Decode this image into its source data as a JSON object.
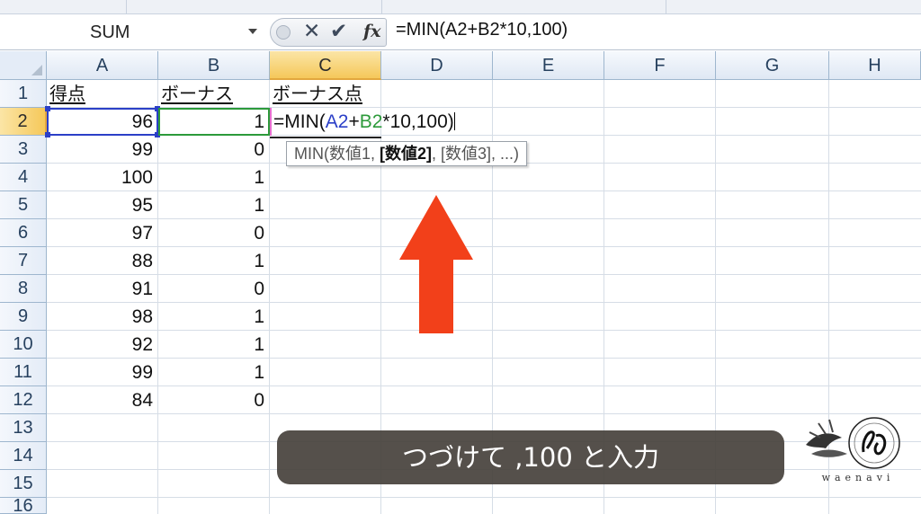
{
  "formula_bar": {
    "name_box": "SUM",
    "cancel_glyph": "✕",
    "enter_glyph": "✔",
    "fx_label": "fx",
    "content": "=MIN(A2+B2*10,100)"
  },
  "columns": [
    "A",
    "B",
    "C",
    "D",
    "E",
    "F",
    "G",
    "H"
  ],
  "active_column": "C",
  "rows": [
    "1",
    "2",
    "3",
    "4",
    "5",
    "6",
    "7",
    "8",
    "9",
    "10",
    "11",
    "12",
    "13",
    "14",
    "15",
    "16"
  ],
  "active_row": "2",
  "headers": {
    "a1": "得点",
    "b1": "ボーナス",
    "c1": "ボーナス点"
  },
  "data_rows": [
    {
      "score": "96",
      "bonus": "1"
    },
    {
      "score": "99",
      "bonus": "0"
    },
    {
      "score": "100",
      "bonus": "1"
    },
    {
      "score": "95",
      "bonus": "1"
    },
    {
      "score": "97",
      "bonus": "0"
    },
    {
      "score": "88",
      "bonus": "1"
    },
    {
      "score": "91",
      "bonus": "0"
    },
    {
      "score": "98",
      "bonus": "1"
    },
    {
      "score": "92",
      "bonus": "1"
    },
    {
      "score": "99",
      "bonus": "1"
    },
    {
      "score": "84",
      "bonus": "0"
    }
  ],
  "cell_edit": {
    "prefix": "=MIN(",
    "ref_a": "A2",
    "plus": "+",
    "ref_b": "B2",
    "suffix": "*10,100)"
  },
  "tooltip": {
    "before": "MIN(数値1, ",
    "bold": "[数値2]",
    "after": ", [数値3], ...)"
  },
  "caption": "つづけて ,100 と入力",
  "logo_text": "waenavi",
  "colors": {
    "ref_a": "#2b3fc7",
    "ref_b": "#2c9a3a",
    "arrow": "#f2401a",
    "active_header": "#f5c85a"
  }
}
